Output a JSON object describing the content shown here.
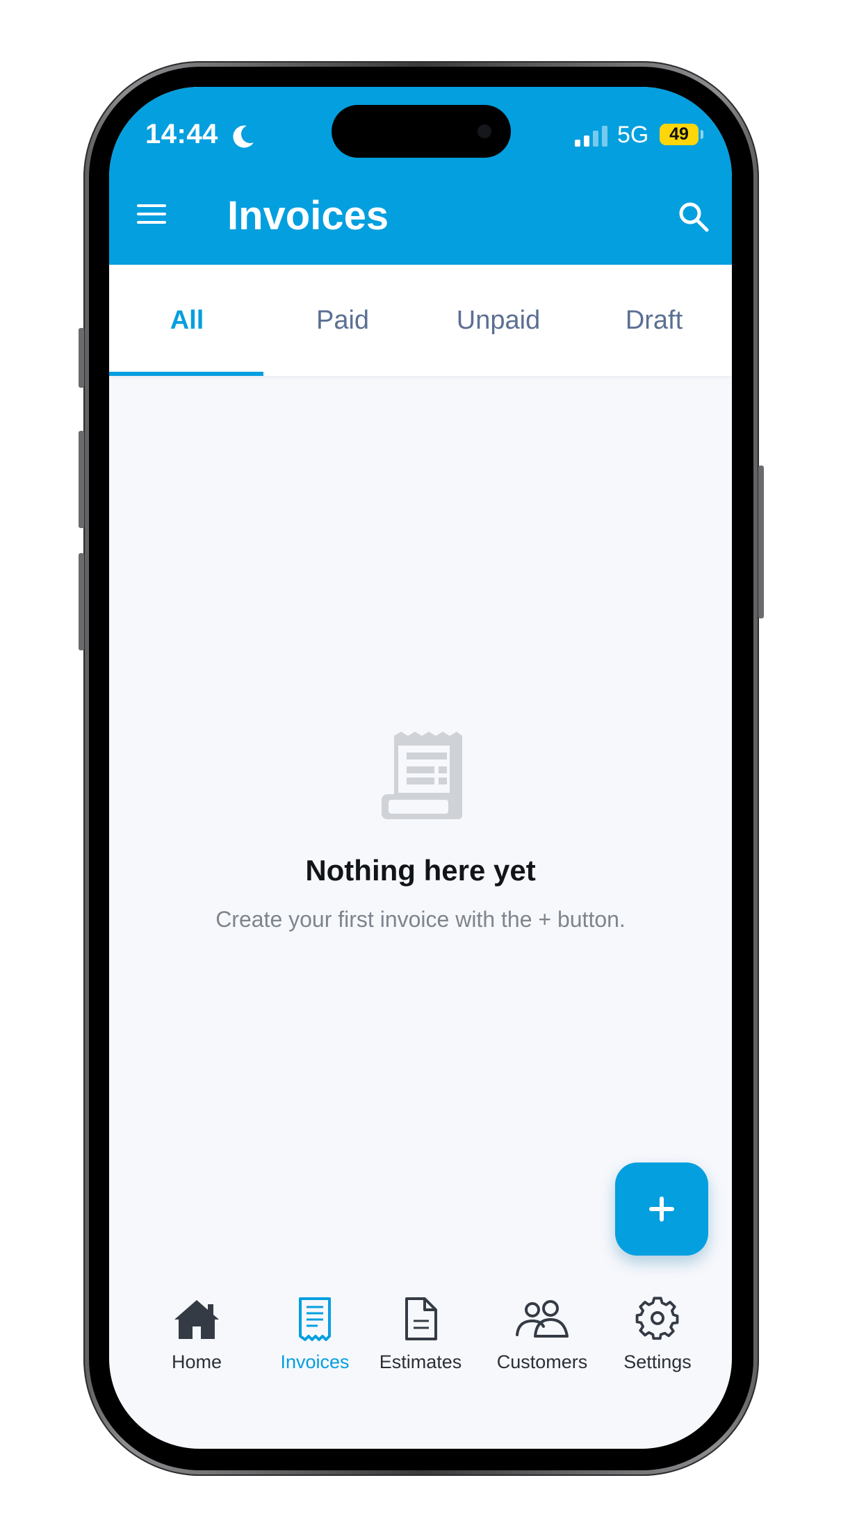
{
  "status_bar": {
    "time": "14:44",
    "network": "5G",
    "battery": "49"
  },
  "header": {
    "title": "Invoices",
    "menu_icon": "hamburger-menu-icon",
    "search_icon": "search-icon",
    "background_color": "#049fdf"
  },
  "tabs": [
    {
      "label": "All",
      "active": true
    },
    {
      "label": "Paid",
      "active": false
    },
    {
      "label": "Unpaid",
      "active": false
    },
    {
      "label": "Draft",
      "active": false
    }
  ],
  "empty_state": {
    "icon": "receipt-icon",
    "title": "Nothing here yet",
    "subtitle": "Create your first invoice with the + button."
  },
  "fab": {
    "icon": "plus-icon"
  },
  "bottom_nav": [
    {
      "label": "Home",
      "icon": "home-icon",
      "active": false
    },
    {
      "label": "Invoices",
      "icon": "invoice-icon",
      "active": true
    },
    {
      "label": "Estimates",
      "icon": "document-icon",
      "active": false
    },
    {
      "label": "Customers",
      "icon": "users-icon",
      "active": false
    },
    {
      "label": "Settings",
      "icon": "gear-icon",
      "active": false
    }
  ],
  "colors": {
    "accent": "#049fdf",
    "nav_text": "#2b2f36",
    "tab_inactive": "#5b6f93",
    "background": "#f6f8fc"
  }
}
